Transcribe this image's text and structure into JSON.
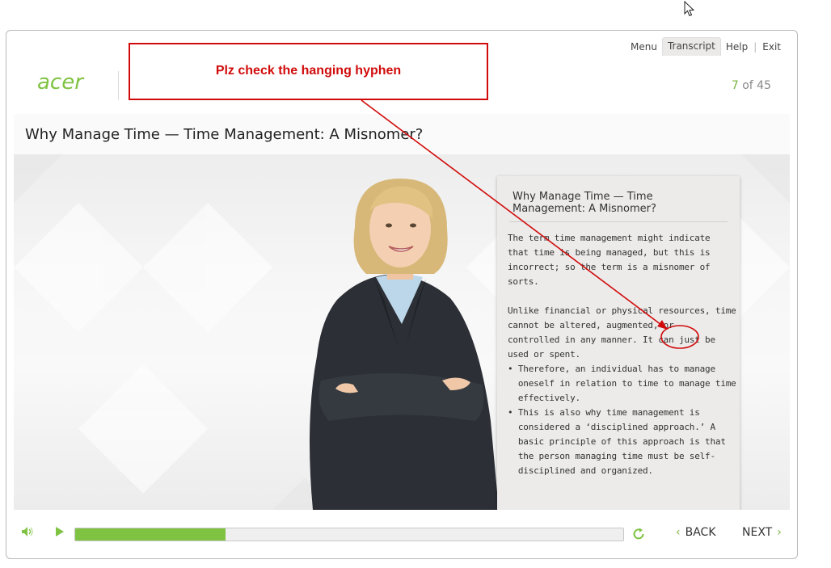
{
  "brand": {
    "logo_text": "acer",
    "accent_color": "#80c342"
  },
  "top_menu": {
    "menu": "Menu",
    "transcript": "Transcript",
    "help": "Help",
    "exit": "Exit",
    "separator": "|"
  },
  "slide": {
    "title": "Why Manage Time — Time Management: A Misnomer?",
    "counter_current": "7",
    "counter_total": " of 45"
  },
  "transcript": {
    "title": "Why Manage Time — Time Management: A Misnomer?",
    "lines": [
      "The term time management might indicate",
      "that time is being managed, but this is",
      "incorrect; so the term is a misnomer of",
      "sorts.",
      "",
      "Unlike financial or physical resources, time",
      "cannot be altered, augmented, or",
      "controlled in any manner. It can just be",
      "used or spent.",
      "• Therefore, an individual has to manage",
      "  oneself in relation to time to manage time",
      "  effectively.",
      "• This is also why time management is",
      "  considered a ‘disciplined approach.’ A",
      "  basic principle of this approach is that",
      "  the person managing time must be self-",
      "  disciplined and organized."
    ]
  },
  "footer": {
    "back_label": "BACK",
    "next_label": "NEXT",
    "progress_fraction": 0.275,
    "icons": {
      "volume": "volume-icon",
      "play": "play-icon",
      "replay": "replay-icon",
      "back_chevron": "chevron-left-icon",
      "next_chevron": "chevron-right-icon"
    }
  },
  "annotation": {
    "callout_text": "Plz check the hanging hyphen",
    "color": "#d10b0b"
  }
}
